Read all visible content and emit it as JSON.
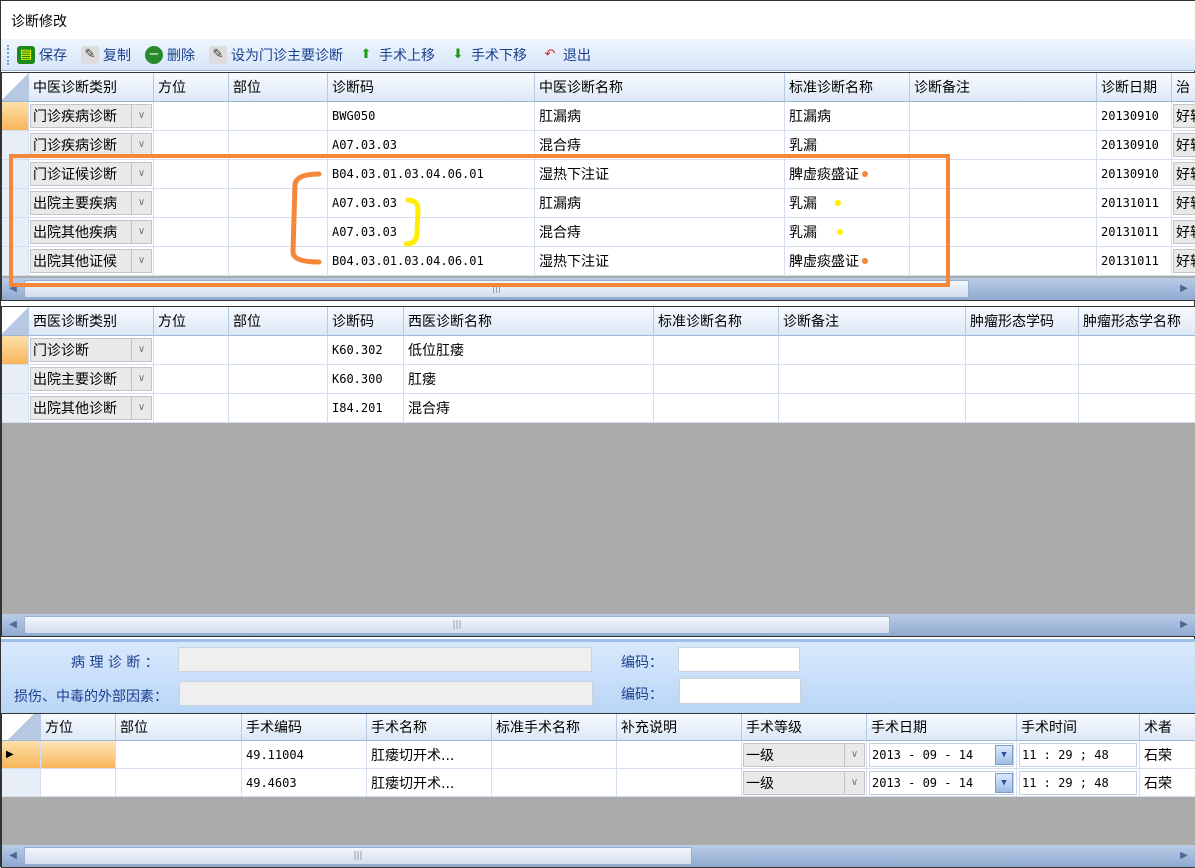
{
  "window": {
    "title": "诊断修改"
  },
  "toolbar": {
    "items": [
      {
        "label": "保存",
        "icon": "save-icon"
      },
      {
        "label": "复制",
        "icon": "copy-icon"
      },
      {
        "label": "删除",
        "icon": "delete-icon"
      },
      {
        "label": "设为门诊主要诊断",
        "icon": "set-primary-icon"
      },
      {
        "label": "手术上移",
        "icon": "arrow-up-icon"
      },
      {
        "label": "手术下移",
        "icon": "arrow-down-icon"
      },
      {
        "label": "退出",
        "icon": "exit-icon"
      }
    ]
  },
  "tcm_grid": {
    "columns": [
      "中医诊断类别",
      "方位",
      "部位",
      "诊断码",
      "中医诊断名称",
      "标准诊断名称",
      "诊断备注",
      "诊断日期",
      "治"
    ],
    "rows": [
      [
        "门诊疾病诊断",
        "",
        "",
        "BWG050",
        "肛漏病",
        "肛漏病",
        "",
        "20130910",
        "好转"
      ],
      [
        "门诊疾病诊断",
        "",
        "",
        "A07.03.03",
        "混合痔",
        "乳漏",
        "",
        "20130910",
        "好转"
      ],
      [
        "门诊证候诊断",
        "",
        "",
        "B04.03.01.03.04.06.01",
        "湿热下注证",
        "脾虚痰盛证",
        "",
        "20130910",
        "好转"
      ],
      [
        "出院主要疾病",
        "",
        "",
        "A07.03.03",
        "肛漏病",
        "乳漏",
        "",
        "20131011",
        "好转"
      ],
      [
        "出院其他疾病",
        "",
        "",
        "A07.03.03",
        "混合痔",
        "乳漏",
        "",
        "20131011",
        "好转"
      ],
      [
        "出院其他证候",
        "",
        "",
        "B04.03.01.03.04.06.01",
        "湿热下注证",
        "脾虚痰盛证",
        "",
        "20131011",
        "好转"
      ]
    ],
    "annotation_colors": {
      "box": "#f5873a",
      "bracket_left": "#f5873a",
      "bracket_right": "#ffee00",
      "dot_orange": "#f5873a",
      "dot_yellow": "#ffee00"
    }
  },
  "wm_grid": {
    "columns": [
      "西医诊断类别",
      "方位",
      "部位",
      "诊断码",
      "西医诊断名称",
      "标准诊断名称",
      "诊断备注",
      "肿瘤形态学码",
      "肿瘤形态学名称"
    ],
    "rows": [
      [
        "门诊诊断",
        "",
        "",
        "K60.302",
        "低位肛瘘",
        "",
        "",
        "",
        ""
      ],
      [
        "出院主要诊断",
        "",
        "",
        "K60.300",
        "肛瘘",
        "",
        "",
        "",
        ""
      ],
      [
        "出院其他诊断",
        "",
        "",
        "I84.201",
        "混合痔",
        "",
        "",
        "",
        ""
      ]
    ]
  },
  "form": {
    "pathology_label": "病 理 诊 断 ：",
    "pathology_value": "",
    "injury_label": "损伤、中毒的外部因素：",
    "injury_value": "",
    "code_label": "编码：",
    "code1_value": "",
    "code2_value": ""
  },
  "surgery_grid": {
    "columns": [
      "方位",
      "部位",
      "手术编码",
      "手术名称",
      "标准手术名称",
      "补充说明",
      "手术等级",
      "手术日期",
      "手术时间",
      "术者"
    ],
    "rows": [
      [
        "",
        "",
        "49.11004",
        "肛瘘切开术...",
        "",
        "",
        "一级",
        "2013 - 09 - 14",
        "11 : 29 ; 48",
        "石荣"
      ],
      [
        "",
        "",
        "49.4603",
        "肛瘘切开术...",
        "",
        "",
        "一级",
        "2013 - 09 - 14",
        "11 : 29 ; 48",
        "石荣"
      ]
    ]
  }
}
